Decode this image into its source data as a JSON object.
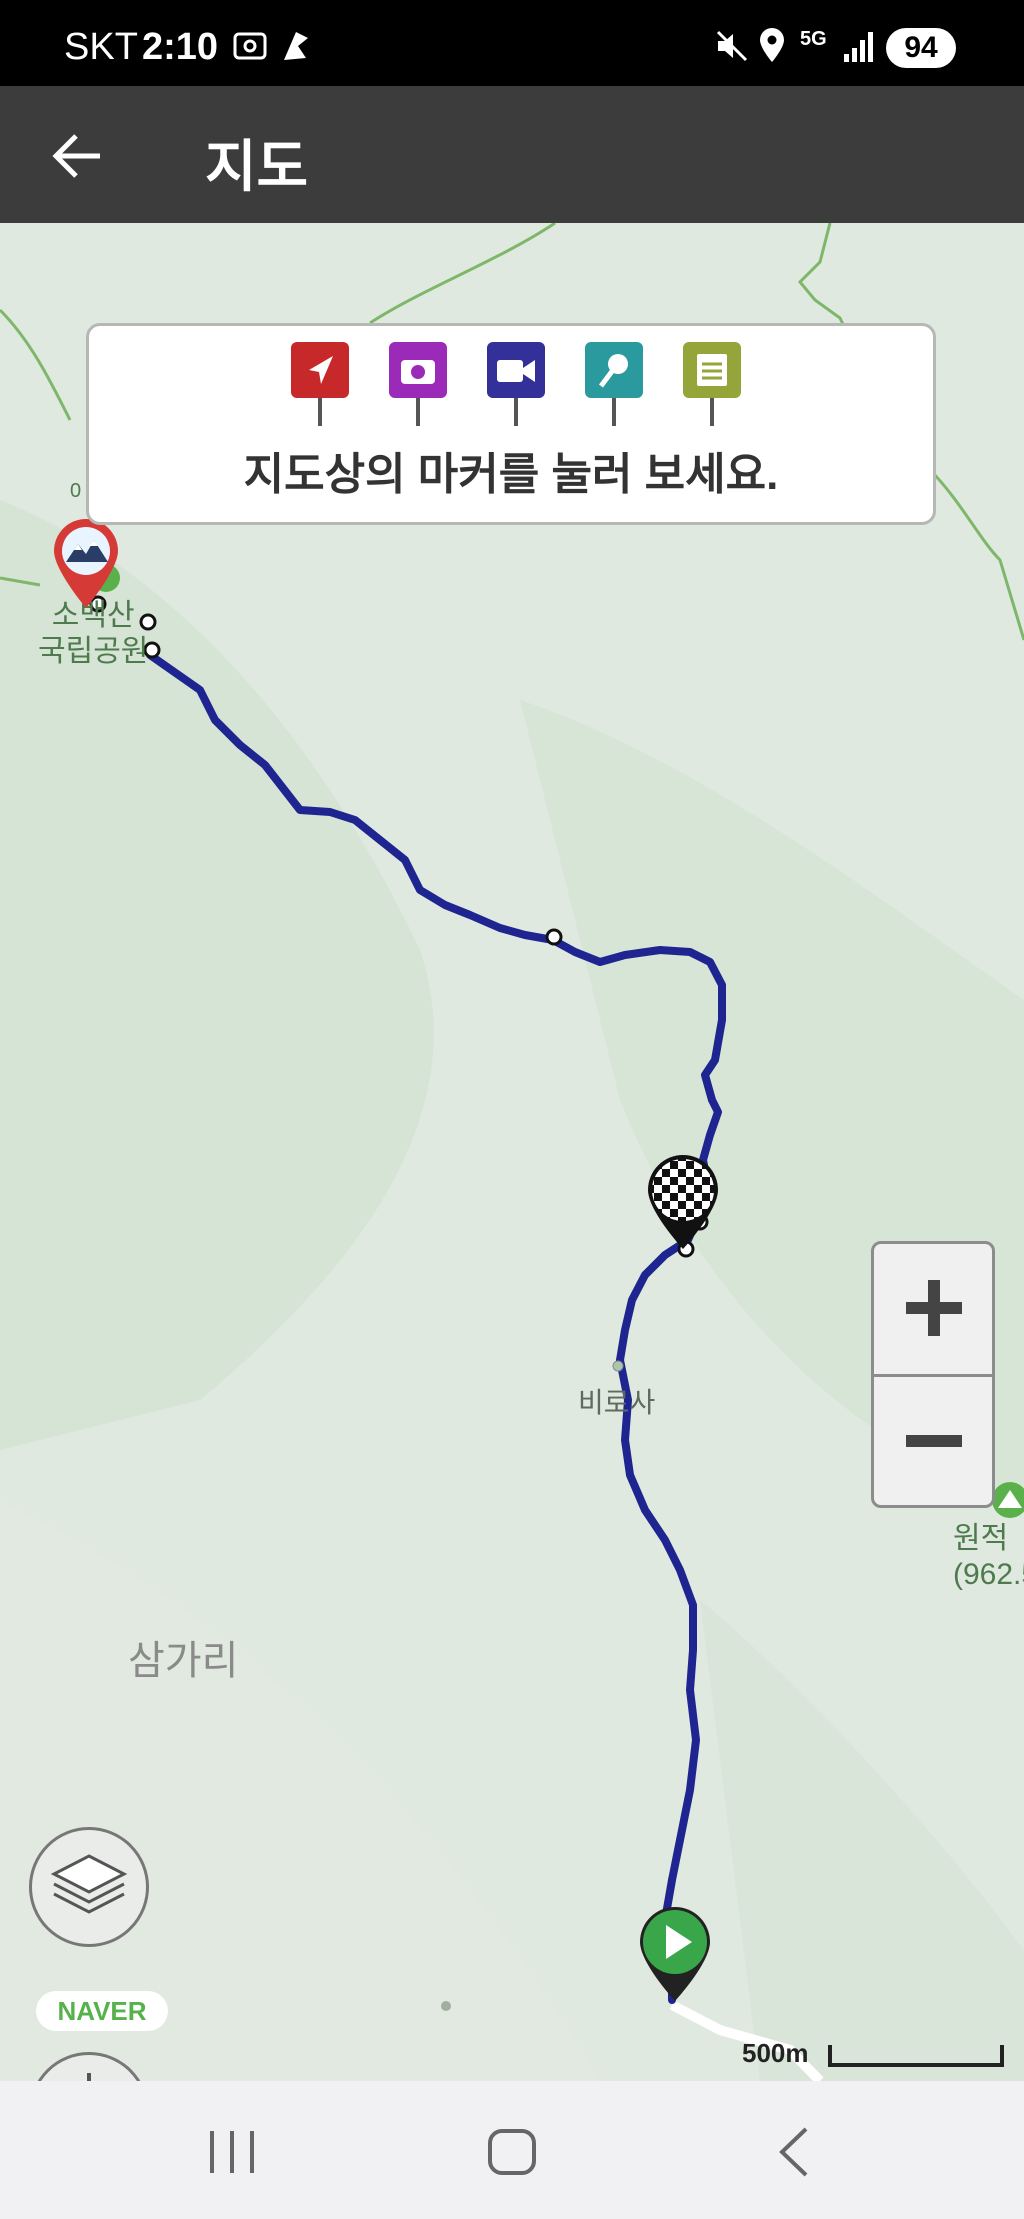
{
  "status_bar": {
    "carrier": "SKT",
    "time": "2:10",
    "network": "5G",
    "battery": "94"
  },
  "app_bar": {
    "title": "지도",
    "back_icon": "arrow-left-icon"
  },
  "banner": {
    "instruction": "지도상의 마커를 눌러 보세요.",
    "marker_types": [
      {
        "icon": "navigation-arrow-icon",
        "color": "#c7282a"
      },
      {
        "icon": "camera-icon",
        "color": "#9a2ab7"
      },
      {
        "icon": "video-camera-icon",
        "color": "#34309a"
      },
      {
        "icon": "microphone-icon",
        "color": "#2a9a9e"
      },
      {
        "icon": "notepad-icon",
        "color": "#95a53a"
      }
    ]
  },
  "map": {
    "labels": {
      "park_line1": "소백산",
      "park_line2": "국립공원",
      "temple": "비로사",
      "peak_line1": "원적",
      "peak_line2": "(962.5",
      "village": "삼가리",
      "edge_tick": "0"
    },
    "route_color": "#1f2590",
    "scale": "500m",
    "provider": "NAVER"
  },
  "controls": {
    "zoom_in_icon": "plus-icon",
    "zoom_out_icon": "minus-icon",
    "layers_icon": "layers-icon",
    "home_location_icon": "crosshair-h-icon"
  },
  "nav_bar": {
    "recents_icon": "recents-icon",
    "home_icon": "home-icon",
    "back_icon": "back-chevron-icon"
  }
}
